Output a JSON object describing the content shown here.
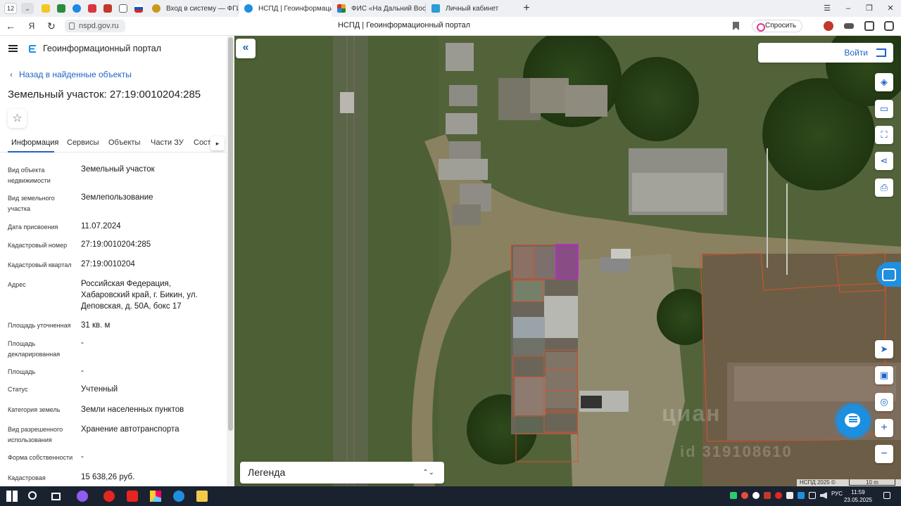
{
  "browser": {
    "tab_counter": "12",
    "tabs": [
      {
        "title": "Вход в систему — ФГИС",
        "favicon_color": "#c79a1a"
      },
      {
        "title": "НСПД | Геоинформацио",
        "favicon_color": "#1f8fe0"
      },
      {
        "title": "ФИС «На Дальний Восто",
        "favicon_color": "#e6a21a"
      },
      {
        "title": "Личный кабинет",
        "favicon_color": "#2e9cd6"
      }
    ],
    "url": "nspd.gov.ru",
    "page_title": "НСПД | Геоинформационный портал",
    "ask_label": "Спросить"
  },
  "header": {
    "portal_title": "Геоинформационный портал"
  },
  "panel": {
    "back_label": "Назад в найденные объекты",
    "object_title": "Земельный участок: 27:19:0010204:285",
    "tabs": [
      "Информация",
      "Сервисы",
      "Объекты",
      "Части ЗУ",
      "Соста"
    ],
    "rows": [
      {
        "label": "Вид объекта недвижимости",
        "value": "Земельный участок"
      },
      {
        "label": "Вид земельного участка",
        "value": "Землепользование"
      },
      {
        "label": "Дата присвоения",
        "value": "11.07.2024"
      },
      {
        "label": "Кадастровый номер",
        "value": "27:19:0010204:285"
      },
      {
        "label": "Кадастровый квартал",
        "value": "27:19:0010204"
      },
      {
        "label": "Адрес",
        "value": "Российская Федерация, Хабаровский край, г. Бикин, ул. Деповская, д. 50А, бокс 17"
      },
      {
        "label": "Площадь уточненная",
        "value": "31 кв. м"
      },
      {
        "label": "Площадь декларированная",
        "value": "-"
      },
      {
        "label": "Площадь",
        "value": "-"
      },
      {
        "label": "Статус",
        "value": "Учтенный"
      },
      {
        "label": "Категория земель",
        "value": "Земли населенных пунктов"
      },
      {
        "label": "Вид разрешенного использования",
        "value": "Хранение автотранспорта"
      },
      {
        "label": "Форма собственности",
        "value": "-"
      },
      {
        "label": "Кадастровая",
        "value": "15 638,26 руб."
      }
    ]
  },
  "map": {
    "login_label": "Войти",
    "legend_label": "Легенда",
    "attribution": "НСПД 2025 ©",
    "scale_label": "10 m",
    "watermark_brand": "циан",
    "watermark_id": "id 319108610"
  },
  "taskbar": {
    "lang": "РУС",
    "time": "11:59",
    "date": "23.05.2025"
  },
  "colors": {
    "accent": "#1f63c8",
    "selected_parcel": "#c21fd6",
    "parcel_outline": "#e0502a"
  },
  "icons": {
    "toolbar": [
      "layers-icon",
      "ruler-icon",
      "select-area-icon",
      "share-icon",
      "print-icon"
    ],
    "map_controls": [
      "locate-icon",
      "minimap-icon",
      "geolocation-icon",
      "zoom-in-icon",
      "zoom-out-icon"
    ]
  }
}
